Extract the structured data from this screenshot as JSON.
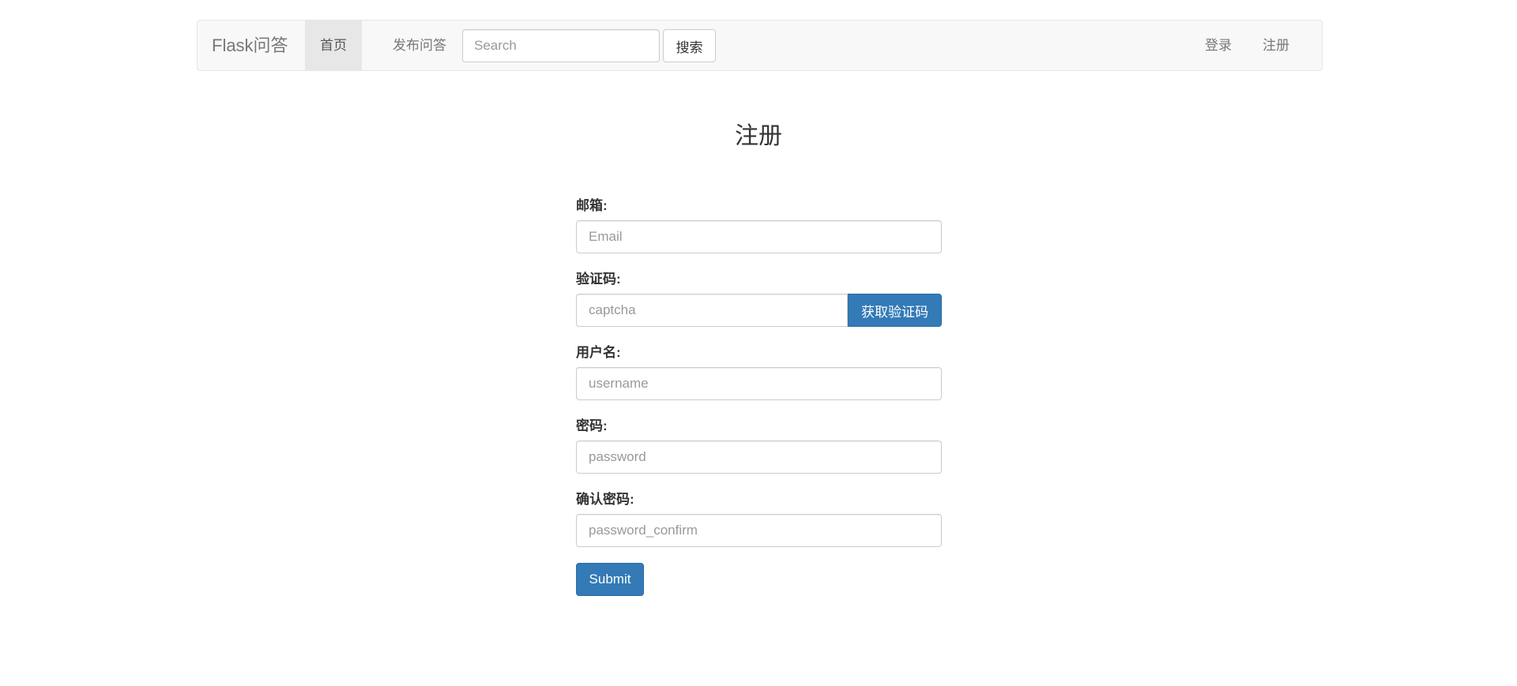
{
  "navbar": {
    "brand": "Flask问答",
    "items": [
      {
        "label": "首页",
        "active": true
      },
      {
        "label": "发布问答",
        "active": false
      }
    ],
    "search": {
      "placeholder": "Search",
      "value": "",
      "button_label": "搜索"
    },
    "right_items": [
      {
        "label": "登录"
      },
      {
        "label": "注册"
      }
    ]
  },
  "page": {
    "title": "注册"
  },
  "form": {
    "email": {
      "label": "邮箱:",
      "placeholder": "Email",
      "value": ""
    },
    "captcha": {
      "label": "验证码:",
      "placeholder": "captcha",
      "value": "",
      "button_label": "获取验证码"
    },
    "username": {
      "label": "用户名:",
      "placeholder": "username",
      "value": ""
    },
    "password": {
      "label": "密码:",
      "placeholder": "password",
      "value": ""
    },
    "password_confirm": {
      "label": "确认密码:",
      "placeholder": "password_confirm",
      "value": ""
    },
    "submit_label": "Submit"
  },
  "colors": {
    "primary": "#337ab7",
    "navbar_bg": "#f8f8f8",
    "active_nav_bg": "#e7e7e7"
  }
}
